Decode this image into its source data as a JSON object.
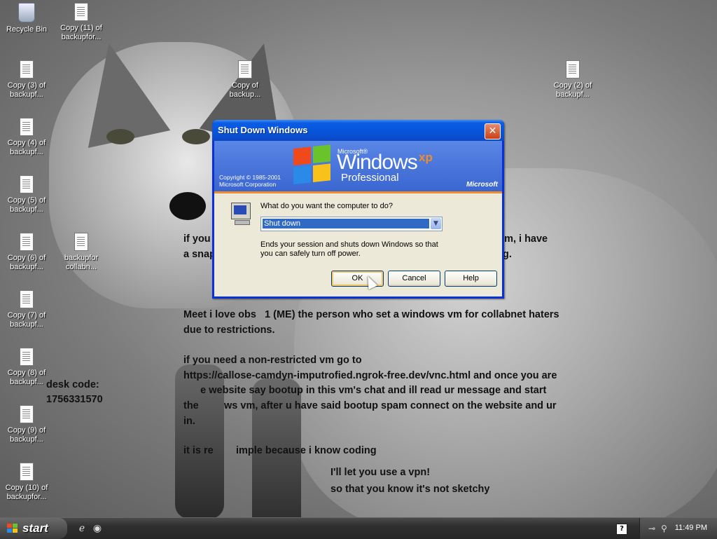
{
  "desktop": {
    "icons": [
      {
        "id": "recycle",
        "label": "Recycle Bin"
      },
      {
        "id": "copy11",
        "label": "Copy (11) of\nbackupfor..."
      },
      {
        "id": "copy3",
        "label": "Copy (3) of\nbackupf..."
      },
      {
        "id": "copy",
        "label": "Copy of\nbackup..."
      },
      {
        "id": "copy2",
        "label": "Copy (2) of\nbackupf..."
      },
      {
        "id": "copy4",
        "label": "Copy (4) of\nbackupf..."
      },
      {
        "id": "copy5",
        "label": "Copy (5) of\nbackupf..."
      },
      {
        "id": "copy6",
        "label": "Copy (6) of\nbackupf..."
      },
      {
        "id": "backupfor",
        "label": "backupfor\ncollabn..."
      },
      {
        "id": "copy7",
        "label": "Copy (7) of\nbackupf..."
      },
      {
        "id": "copy8",
        "label": "Copy (8) of\nbackupf..."
      },
      {
        "id": "copy9",
        "label": "Copy (9) of\nbackupf..."
      },
      {
        "id": "copy10",
        "label": "Copy (10) of\nbackupfor..."
      }
    ],
    "text_lines": {
      "line1_left": "if you l",
      "line1_right": "vm, i have",
      "line2_left": "a snap",
      "line2_right": "g.",
      "line3": "Meet i love obs   1 (ME) the person who set a windows vm for collabnet haters",
      "line4": "due to restrictions.",
      "line5": "if you need a non-restricted vm go to",
      "line6": "https://callose-camdyn-imputrofied.ngrok-free.dev/vnc.html and once you are",
      "line7": "      e website say bootup in this vm's chat and ill read ur message and start",
      "line8": "the         ws vm, after u have said bootup spam connect on the website and ur",
      "line9": "in.",
      "line10": "it is re        imple because i know coding",
      "line11": "I'll let you use a vpn!",
      "line12": "so that you know it's not sketchy",
      "anydesk1": "desk code:",
      "anydesk2": "1756331570"
    }
  },
  "dialog": {
    "title": "Shut Down Windows",
    "close_glyph": "✕",
    "banner": {
      "microsoft_small": "Microsoft®",
      "windows": "Windows",
      "xp": "xp",
      "edition": "Professional",
      "copyright": "Copyright © 1985-2001\nMicrosoft Corporation",
      "brand": "Microsoft"
    },
    "question": "What do you want the computer to do?",
    "selected_option": "Shut down",
    "description": "Ends your session and shuts down Windows so that you can safely turn off power.",
    "buttons": {
      "ok": "OK",
      "cancel": "Cancel",
      "help": "Help"
    }
  },
  "taskbar": {
    "start_label": "start",
    "clock": "11:49 PM",
    "help_glyph": "?"
  },
  "colors": {
    "dialog_frame": "#0831d9",
    "accent_orange": "#f08c2a",
    "selection": "#316ac5"
  }
}
